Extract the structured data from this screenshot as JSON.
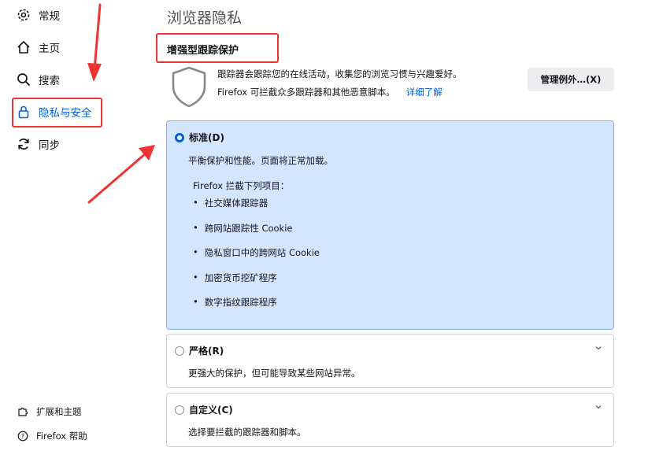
{
  "sidebar": {
    "items": [
      {
        "label": "常规",
        "icon": "gear-icon"
      },
      {
        "label": "主页",
        "icon": "home-icon"
      },
      {
        "label": "搜索",
        "icon": "search-icon"
      },
      {
        "label": "隐私与安全",
        "icon": "lock-icon",
        "selected": true
      },
      {
        "label": "同步",
        "icon": "sync-icon"
      }
    ],
    "footer": [
      {
        "label": "扩展和主题",
        "icon": "puzzle-icon"
      },
      {
        "label": "Firefox 帮助",
        "icon": "help-icon"
      }
    ]
  },
  "main": {
    "page_title": "浏览器隐私",
    "section_title": "增强型跟踪保护",
    "description_line1": "跟踪器会跟踪您的在线活动，收集您的浏览习惯与兴趣爱好。",
    "description_line2": "Firefox 可拦截众多跟踪器和其他恶意脚本。",
    "learn_more": "详细了解",
    "exceptions_button": "管理例外…(X)",
    "options": {
      "standard": {
        "label": "标准(D)",
        "description": "平衡保护和性能。页面将正常加载。",
        "blocks_title": "Firefox 拦截下列项目：",
        "blocks": [
          "社交媒体跟踪器",
          "跨网站跟踪性 Cookie",
          "隐私窗口中的跨网站 Cookie",
          "加密货币挖矿程序",
          "数字指纹跟踪程序"
        ]
      },
      "strict": {
        "label": "严格(R)",
        "description": "更强大的保护，但可能导致某些网站异常。"
      },
      "custom": {
        "label": "自定义(C)",
        "description": "选择要拦截的跟踪器和脚本。"
      }
    }
  },
  "colors": {
    "accent": "#0061e0",
    "annotation": "#e33333",
    "selected_bg": "#d4e6ff"
  }
}
